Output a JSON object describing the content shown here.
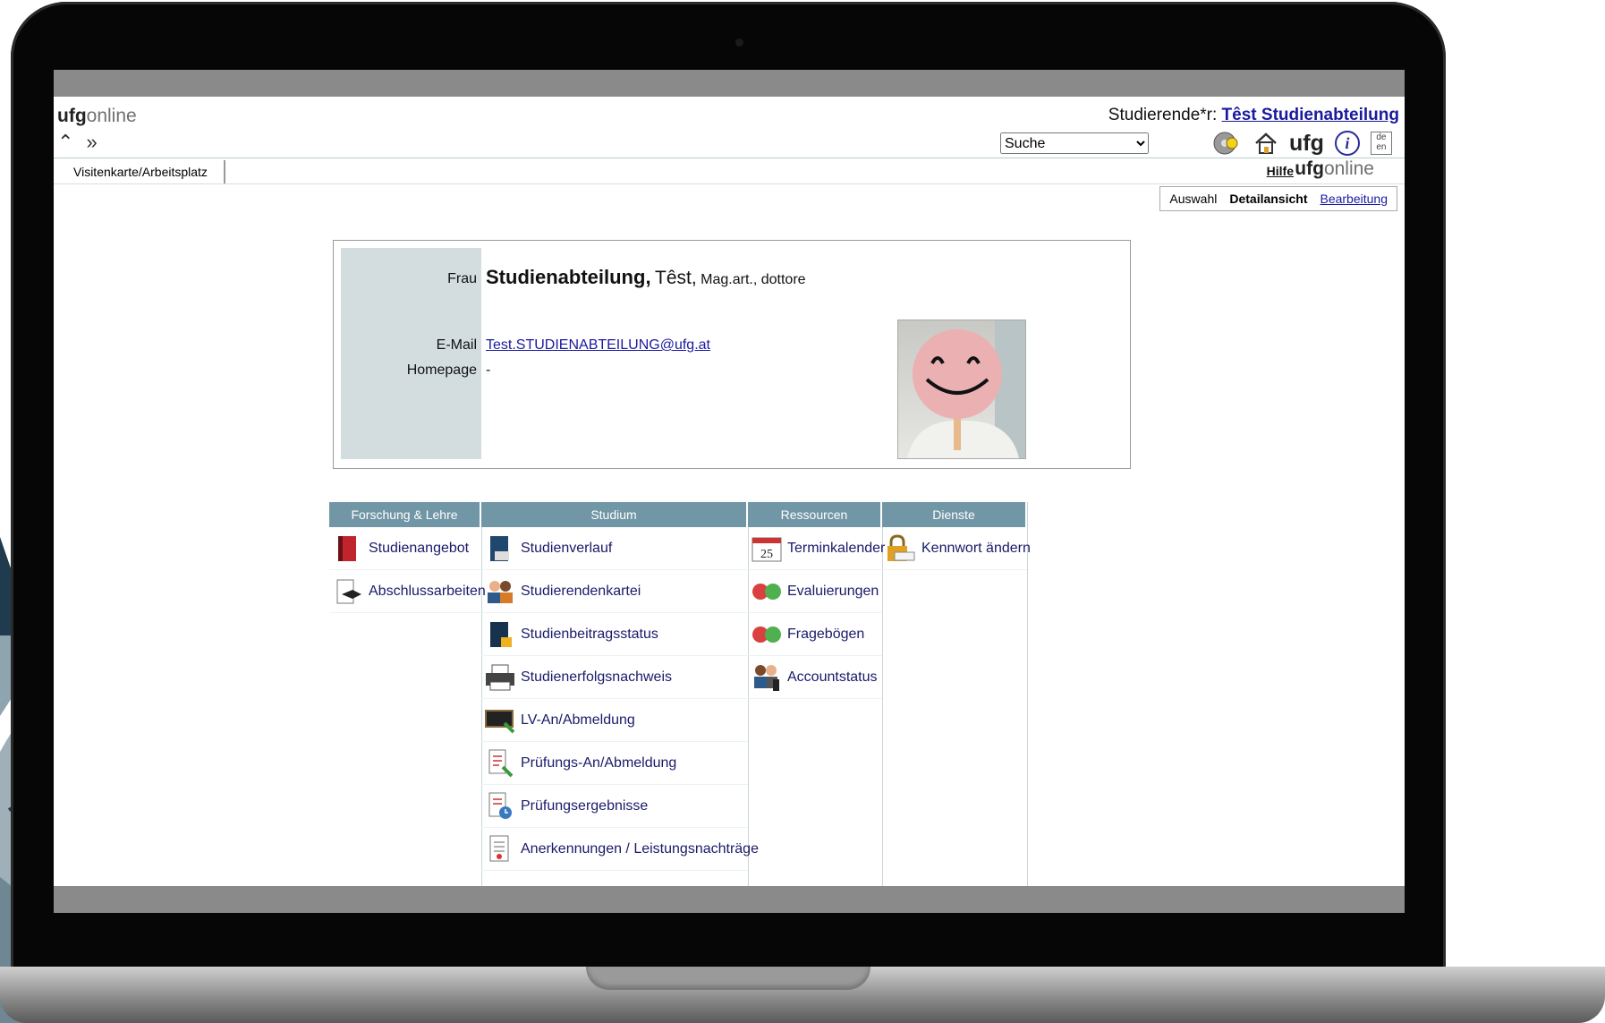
{
  "header": {
    "logo_bold": "ufg",
    "logo_light": "online",
    "nav_arrows": "⌃ »",
    "user_prefix": "Studierende*r:",
    "user_name": "Têst Studienabteilung",
    "search_value": "Suche",
    "icon_ufg_text": "ufg",
    "icon_info_text": "i",
    "icon_lang_text": "de en"
  },
  "tabs": {
    "main_tab": "Visitenkarte/Arbeitsplatz",
    "help": "Hilfe",
    "logo_bold": "ufg",
    "logo_light": "online"
  },
  "view_tabs": {
    "selection": "Auswahl",
    "detail": "Detailansicht",
    "edit": "Bearbeitung"
  },
  "card": {
    "salutation_label": "Frau",
    "surname": "Studienabteilung,",
    "firstname": "Têst,",
    "titles": "Mag.art., dottore",
    "email_label": "E-Mail",
    "email_value": "Test.STUDIENABTEILUNG@ufg.at",
    "homepage_label": "Homepage",
    "homepage_value": "-"
  },
  "menu": {
    "columns": [
      {
        "title": "Forschung & Lehre",
        "items": [
          "Studienangebot",
          "Abschlussarbeiten"
        ]
      },
      {
        "title": "Studium",
        "items": [
          "Studienverlauf",
          "Studierendenkartei",
          "Studienbeitragsstatus",
          "Studienerfolgsnachweis",
          "LV-An/Abmeldung",
          "Prüfungs-An/Abmeldung",
          "Prüfungsergebnisse",
          "Anerkennungen / Leistungsnachträge"
        ]
      },
      {
        "title": "Ressourcen",
        "items": [
          "Terminkalender",
          "Evaluierungen",
          "Fragebögen",
          "Accountstatus"
        ]
      },
      {
        "title": "Dienste",
        "items": [
          "Kennwort ändern"
        ]
      }
    ],
    "calendar_day": "25"
  },
  "colors": {
    "menu_header": "#7196a5",
    "card_side": "#d3dde0",
    "link": "#1a1aa0"
  }
}
